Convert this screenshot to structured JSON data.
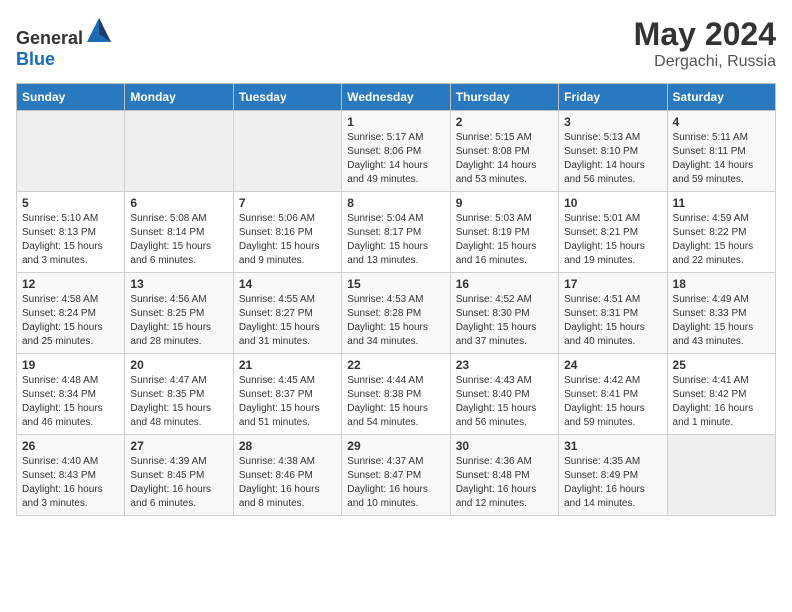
{
  "header": {
    "logo_general": "General",
    "logo_blue": "Blue",
    "title": "May 2024",
    "location": "Dergachi, Russia"
  },
  "days_of_week": [
    "Sunday",
    "Monday",
    "Tuesday",
    "Wednesday",
    "Thursday",
    "Friday",
    "Saturday"
  ],
  "weeks": [
    [
      {
        "day": "",
        "sunrise": "",
        "sunset": "",
        "daylight": "",
        "empty": true
      },
      {
        "day": "",
        "sunrise": "",
        "sunset": "",
        "daylight": "",
        "empty": true
      },
      {
        "day": "",
        "sunrise": "",
        "sunset": "",
        "daylight": "",
        "empty": true
      },
      {
        "day": "1",
        "sunrise": "Sunrise: 5:17 AM",
        "sunset": "Sunset: 8:06 PM",
        "daylight": "Daylight: 14 hours and 49 minutes."
      },
      {
        "day": "2",
        "sunrise": "Sunrise: 5:15 AM",
        "sunset": "Sunset: 8:08 PM",
        "daylight": "Daylight: 14 hours and 53 minutes."
      },
      {
        "day": "3",
        "sunrise": "Sunrise: 5:13 AM",
        "sunset": "Sunset: 8:10 PM",
        "daylight": "Daylight: 14 hours and 56 minutes."
      },
      {
        "day": "4",
        "sunrise": "Sunrise: 5:11 AM",
        "sunset": "Sunset: 8:11 PM",
        "daylight": "Daylight: 14 hours and 59 minutes."
      }
    ],
    [
      {
        "day": "5",
        "sunrise": "Sunrise: 5:10 AM",
        "sunset": "Sunset: 8:13 PM",
        "daylight": "Daylight: 15 hours and 3 minutes."
      },
      {
        "day": "6",
        "sunrise": "Sunrise: 5:08 AM",
        "sunset": "Sunset: 8:14 PM",
        "daylight": "Daylight: 15 hours and 6 minutes."
      },
      {
        "day": "7",
        "sunrise": "Sunrise: 5:06 AM",
        "sunset": "Sunset: 8:16 PM",
        "daylight": "Daylight: 15 hours and 9 minutes."
      },
      {
        "day": "8",
        "sunrise": "Sunrise: 5:04 AM",
        "sunset": "Sunset: 8:17 PM",
        "daylight": "Daylight: 15 hours and 13 minutes."
      },
      {
        "day": "9",
        "sunrise": "Sunrise: 5:03 AM",
        "sunset": "Sunset: 8:19 PM",
        "daylight": "Daylight: 15 hours and 16 minutes."
      },
      {
        "day": "10",
        "sunrise": "Sunrise: 5:01 AM",
        "sunset": "Sunset: 8:21 PM",
        "daylight": "Daylight: 15 hours and 19 minutes."
      },
      {
        "day": "11",
        "sunrise": "Sunrise: 4:59 AM",
        "sunset": "Sunset: 8:22 PM",
        "daylight": "Daylight: 15 hours and 22 minutes."
      }
    ],
    [
      {
        "day": "12",
        "sunrise": "Sunrise: 4:58 AM",
        "sunset": "Sunset: 8:24 PM",
        "daylight": "Daylight: 15 hours and 25 minutes."
      },
      {
        "day": "13",
        "sunrise": "Sunrise: 4:56 AM",
        "sunset": "Sunset: 8:25 PM",
        "daylight": "Daylight: 15 hours and 28 minutes."
      },
      {
        "day": "14",
        "sunrise": "Sunrise: 4:55 AM",
        "sunset": "Sunset: 8:27 PM",
        "daylight": "Daylight: 15 hours and 31 minutes."
      },
      {
        "day": "15",
        "sunrise": "Sunrise: 4:53 AM",
        "sunset": "Sunset: 8:28 PM",
        "daylight": "Daylight: 15 hours and 34 minutes."
      },
      {
        "day": "16",
        "sunrise": "Sunrise: 4:52 AM",
        "sunset": "Sunset: 8:30 PM",
        "daylight": "Daylight: 15 hours and 37 minutes."
      },
      {
        "day": "17",
        "sunrise": "Sunrise: 4:51 AM",
        "sunset": "Sunset: 8:31 PM",
        "daylight": "Daylight: 15 hours and 40 minutes."
      },
      {
        "day": "18",
        "sunrise": "Sunrise: 4:49 AM",
        "sunset": "Sunset: 8:33 PM",
        "daylight": "Daylight: 15 hours and 43 minutes."
      }
    ],
    [
      {
        "day": "19",
        "sunrise": "Sunrise: 4:48 AM",
        "sunset": "Sunset: 8:34 PM",
        "daylight": "Daylight: 15 hours and 46 minutes."
      },
      {
        "day": "20",
        "sunrise": "Sunrise: 4:47 AM",
        "sunset": "Sunset: 8:35 PM",
        "daylight": "Daylight: 15 hours and 48 minutes."
      },
      {
        "day": "21",
        "sunrise": "Sunrise: 4:45 AM",
        "sunset": "Sunset: 8:37 PM",
        "daylight": "Daylight: 15 hours and 51 minutes."
      },
      {
        "day": "22",
        "sunrise": "Sunrise: 4:44 AM",
        "sunset": "Sunset: 8:38 PM",
        "daylight": "Daylight: 15 hours and 54 minutes."
      },
      {
        "day": "23",
        "sunrise": "Sunrise: 4:43 AM",
        "sunset": "Sunset: 8:40 PM",
        "daylight": "Daylight: 15 hours and 56 minutes."
      },
      {
        "day": "24",
        "sunrise": "Sunrise: 4:42 AM",
        "sunset": "Sunset: 8:41 PM",
        "daylight": "Daylight: 15 hours and 59 minutes."
      },
      {
        "day": "25",
        "sunrise": "Sunrise: 4:41 AM",
        "sunset": "Sunset: 8:42 PM",
        "daylight": "Daylight: 16 hours and 1 minute."
      }
    ],
    [
      {
        "day": "26",
        "sunrise": "Sunrise: 4:40 AM",
        "sunset": "Sunset: 8:43 PM",
        "daylight": "Daylight: 16 hours and 3 minutes."
      },
      {
        "day": "27",
        "sunrise": "Sunrise: 4:39 AM",
        "sunset": "Sunset: 8:45 PM",
        "daylight": "Daylight: 16 hours and 6 minutes."
      },
      {
        "day": "28",
        "sunrise": "Sunrise: 4:38 AM",
        "sunset": "Sunset: 8:46 PM",
        "daylight": "Daylight: 16 hours and 8 minutes."
      },
      {
        "day": "29",
        "sunrise": "Sunrise: 4:37 AM",
        "sunset": "Sunset: 8:47 PM",
        "daylight": "Daylight: 16 hours and 10 minutes."
      },
      {
        "day": "30",
        "sunrise": "Sunrise: 4:36 AM",
        "sunset": "Sunset: 8:48 PM",
        "daylight": "Daylight: 16 hours and 12 minutes."
      },
      {
        "day": "31",
        "sunrise": "Sunrise: 4:35 AM",
        "sunset": "Sunset: 8:49 PM",
        "daylight": "Daylight: 16 hours and 14 minutes."
      },
      {
        "day": "",
        "sunrise": "",
        "sunset": "",
        "daylight": "",
        "empty": true
      }
    ]
  ]
}
